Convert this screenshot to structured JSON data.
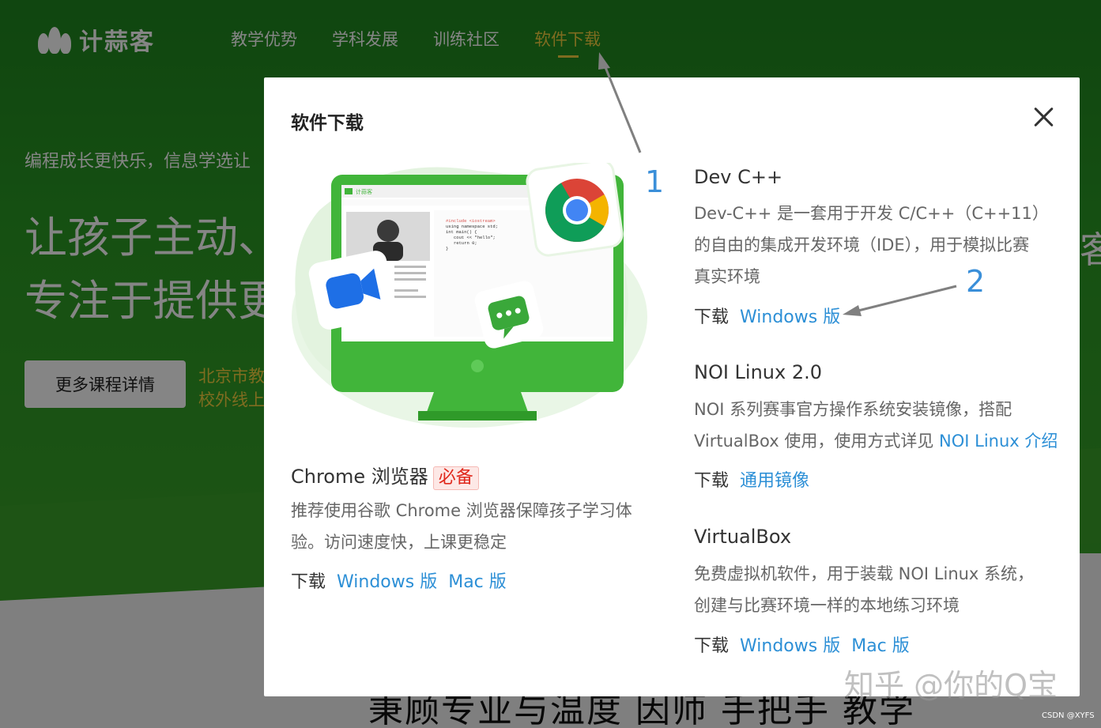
{
  "site": {
    "logo_text": "计蒜客",
    "nav": [
      {
        "label": "教学优势"
      },
      {
        "label": "学科发展"
      },
      {
        "label": "训练社区"
      },
      {
        "label": "软件下载",
        "active": true
      }
    ],
    "hero": {
      "tagline": "编程成长更快乐，信息学选让",
      "title_line1": "让孩子主动、",
      "title_line2": "专注于提供更",
      "button_label": "更多课程详情",
      "side_line1": "北京市教",
      "side_line2": "校外线上",
      "right_peek": "客"
    },
    "bottom_slogan": "秉顾专业与温度 因师 手把手 教学"
  },
  "modal": {
    "title": "软件下载",
    "close_icon": "close-icon",
    "illustration": {
      "app_brand": "计蒜客",
      "code_lines": [
        "#include <iostream>",
        "using namespace std;",
        "int main() {",
        "cout << \"hello\";",
        "return 0;",
        "}"
      ],
      "icons": [
        "chrome-icon",
        "video-camera-icon",
        "chat-bubble-icon"
      ]
    },
    "chrome": {
      "title": "Chrome 浏览器",
      "badge": "必备",
      "desc_line1": "推荐使用谷歌 Chrome 浏览器保障孩子学习体",
      "desc_line2": "验。访问速度快，上课更稳定",
      "dl_label": "下载",
      "links": [
        "Windows 版",
        "Mac 版"
      ]
    },
    "devcpp": {
      "title": "Dev C++",
      "desc_line1": "Dev-C++ 是一套用于开发 C/C++（C++11）",
      "desc_line2": "的自由的集成开发环境（IDE），用于模拟比赛",
      "desc_line3": "真实环境",
      "dl_label": "下载",
      "links": [
        "Windows 版"
      ]
    },
    "noilinux": {
      "title": "NOI Linux 2.0",
      "desc_line1": "NOI 系列赛事官方操作系统安装镜像，搭配",
      "desc_line2_prefix": "VirtualBox 使用，使用方式详见 ",
      "desc_line2_link": "NOI Linux 介绍",
      "dl_label": "下载",
      "links": [
        "通用镜像"
      ]
    },
    "virtualbox": {
      "title": "VirtualBox",
      "desc_line1": "免费虚拟机软件，用于装载 NOI Linux 系统，",
      "desc_line2": "创建与比赛环境一样的本地练习环境",
      "dl_label": "下载",
      "links": [
        "Windows 版",
        "Mac 版"
      ]
    }
  },
  "annotations": {
    "num1": "1",
    "num2": "2",
    "arrow_color": "#808080"
  },
  "watermark": "知乎 @你的Q宝",
  "csdn_mark": "CSDN @XYFS",
  "colors": {
    "brand_green": "#2b9a24",
    "link_blue": "#2c8fd6",
    "badge_red": "#e0281c",
    "nav_active": "#f4d03f"
  }
}
